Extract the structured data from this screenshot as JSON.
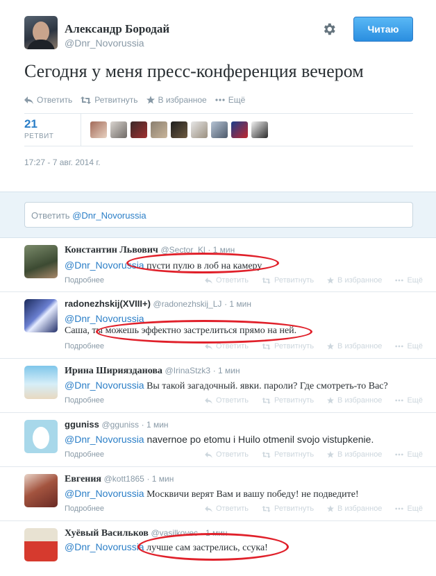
{
  "author": {
    "name": "Александр Бородай",
    "handle": "@Dnr_Novorussia"
  },
  "follow_button": "Читаю",
  "tweet": {
    "text": "Сегодня у меня пресс-конференция вечером",
    "timestamp": "17:27 - 7 авг. 2014 г."
  },
  "actions": {
    "reply": "Ответить",
    "retweet": "Ретвитнуть",
    "favorite": "В избранное",
    "more": "Ещё"
  },
  "stats": {
    "retweet_count": "21",
    "retweet_label": "РЕТВИТ"
  },
  "reply_box": {
    "prefix": "Ответить",
    "handle": "@Dnr_Novorussia"
  },
  "more_label": "Подробнее",
  "replies": [
    {
      "name": "Константин Львович",
      "handle": "@Sector_Kl",
      "time": "· 1 мин",
      "mention": "@Dnr_Novorussia",
      "text": "пусти пулю в лоб на камеру"
    },
    {
      "name": "radonezhskij(XVIII+)",
      "handle": "@radonezhskij_LJ",
      "time": "· 1 мин",
      "mention": "@Dnr_Novorussia",
      "text": "Саша, ты можешь эффектно застрелиться прямо на ней."
    },
    {
      "name": "Ирина Ширияздaнова",
      "handle": "@IrinaStzk3",
      "time": "· 1 мин",
      "mention": "@Dnr_Novorussia",
      "text": "Вы такой загадочный. явки. пароли? Где смотреть-то Вас?"
    },
    {
      "name": "gguniss",
      "handle": "@gguniss",
      "time": "· 1 мин",
      "mention": "@Dnr_Novorussia",
      "text": "navernoe po etomu i Huilo otmenil svojo vistupkenie."
    },
    {
      "name": "Евгения",
      "handle": "@kott1865",
      "time": "· 1 мин",
      "mention": "@Dnr_Novorussia",
      "text": "Москвичи верят Вам и вашу победу! не подведите!"
    },
    {
      "name": "Хуёвый Васильков",
      "handle": "@vasilkovec",
      "time": "· 1 мин",
      "mention": "@Dnr_Novorussia",
      "text": "лучше сам застрелись, ссука!"
    }
  ],
  "colors": {
    "link": "#2a7ec7",
    "follow_button": "#2a8ee0",
    "annotation": "#e0202a",
    "reply_area": "#eaf3f9"
  },
  "icons": [
    "gear-icon",
    "reply-icon",
    "retweet-icon",
    "star-icon",
    "more-icon",
    "egg-icon"
  ]
}
